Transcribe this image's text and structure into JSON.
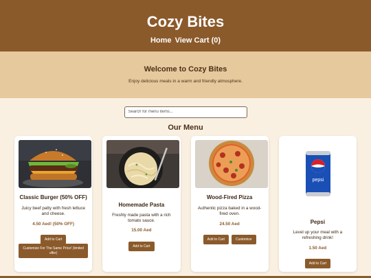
{
  "header": {
    "title": "Cozy Bites",
    "nav": [
      "Home",
      "View Cart (0)"
    ]
  },
  "welcome": {
    "title": "Welcome to Cozy Bites",
    "subtitle": "Enjoy delicious meals in a warm and friendly atmosphere."
  },
  "search": {
    "placeholder": "Search for menu items...",
    "value": ""
  },
  "menu": {
    "title": "Our Menu",
    "items": [
      {
        "name": "Classic Burger (50% OFF)",
        "description": "Juicy beef patty with fresh lettuce and cheese.",
        "price": "4.50 Aed! (50% OFF)",
        "add_label": "Add to Cart",
        "customize_label": "Customize For The Same Price! (limited offer)",
        "image": "burger"
      },
      {
        "name": "Homemade Pasta",
        "description": "Freshly made pasta with a rich tomato sauce.",
        "price": "15.00 Aed",
        "add_label": "Add to Cart",
        "image": "pasta"
      },
      {
        "name": "Wood-Fired Pizza",
        "description": "Authentic pizza baked in a wood-fired oven.",
        "price": "24.50 Aed",
        "add_label": "Add to Cart",
        "customize_label": "Customize",
        "image": "pizza"
      },
      {
        "name": "Pepsi",
        "description": "Level up your meal with a refreshing drink!",
        "price": "1.50 Aed",
        "add_label": "Add to Cart",
        "image": "pepsi-can",
        "can_text": "pepsi"
      }
    ]
  },
  "colors": {
    "brand": "#8b5a2b",
    "banner": "#e6c99c",
    "page_bg": "#faf0e2"
  }
}
